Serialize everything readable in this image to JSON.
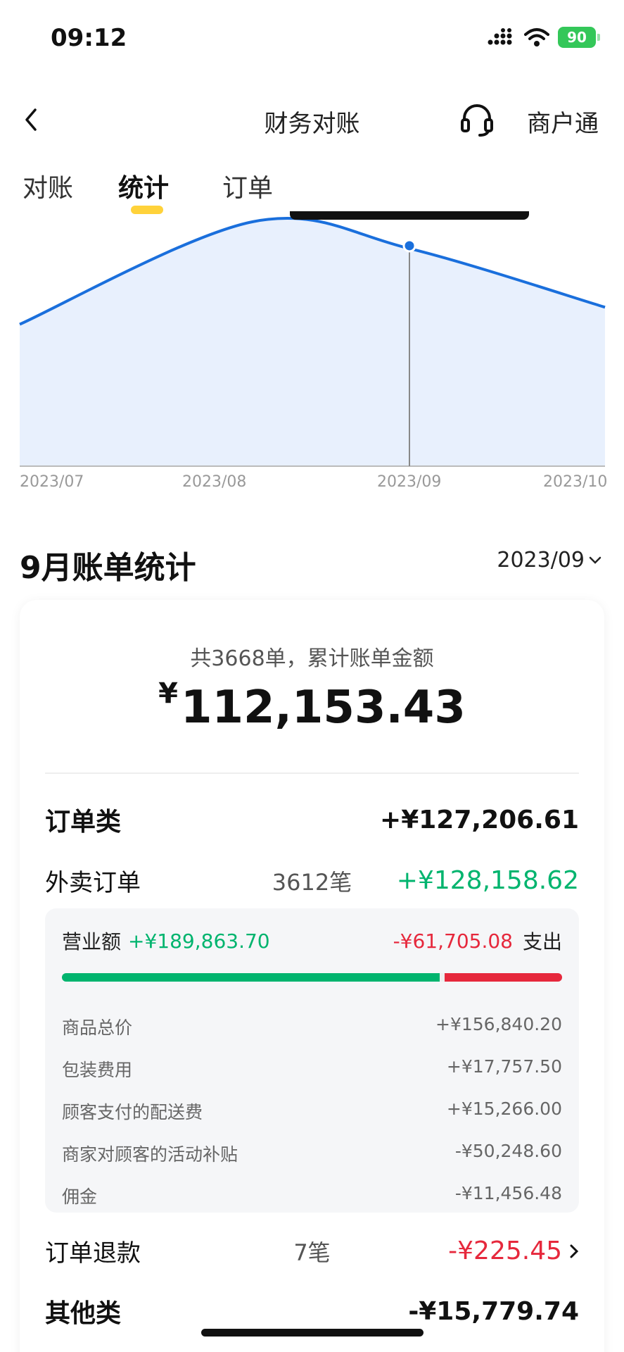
{
  "status": {
    "time": "09:12",
    "battery": "90"
  },
  "nav": {
    "title": "财务对账",
    "merchant": "商户通"
  },
  "tabs": [
    {
      "label": "对账"
    },
    {
      "label": "统计"
    },
    {
      "label": "订单"
    }
  ],
  "chart_data": {
    "type": "area",
    "x": [
      "2023/07",
      "2023/08",
      "2023/09",
      "2023/10"
    ],
    "series": [
      {
        "values": [
          0.58,
          1.0,
          0.89,
          0.65
        ]
      }
    ],
    "highlighted": "2023/09",
    "colors": {
      "line": "#1a6fdc",
      "fill": "#e8f0fd"
    }
  },
  "section": {
    "title": "9月账单统计",
    "month": "2023/09"
  },
  "summary": {
    "count_text": "共3668单，累计账单金额",
    "currency": "¥",
    "amount": "112,153.43"
  },
  "order_category": {
    "label": "订单类",
    "amount": "+¥127,206.61"
  },
  "takeout": {
    "label": "外卖订单",
    "count": "3612笔",
    "amount": "+¥128,158.62"
  },
  "revenue": {
    "label": "营业额",
    "income": "+¥189,863.70",
    "expense": "-¥61,705.08",
    "expense_label": "支出",
    "income_ratio": 0.755
  },
  "details": [
    {
      "label": "商品总价",
      "value": "+¥156,840.20"
    },
    {
      "label": "包装费用",
      "value": "+¥17,757.50"
    },
    {
      "label": "顾客支付的配送费",
      "value": "+¥15,266.00"
    },
    {
      "label": "商家对顾客的活动补贴",
      "value": "-¥50,248.60"
    },
    {
      "label": "佣金",
      "value": "-¥11,456.48"
    }
  ],
  "refund": {
    "label": "订单退款",
    "count": "7笔",
    "amount": "-¥225.45"
  },
  "other_category": {
    "label": "其他类",
    "amount": "-¥15,779.74"
  },
  "colors": {
    "green": "#00b46e",
    "red": "#e6283c",
    "accent": "#ffd23a"
  }
}
